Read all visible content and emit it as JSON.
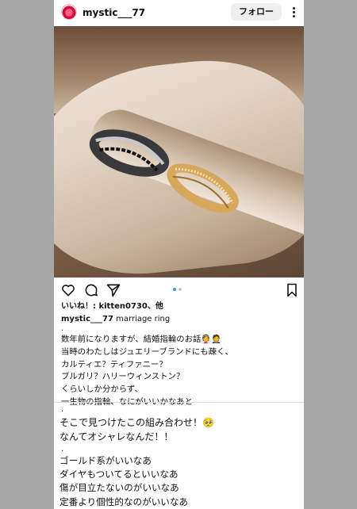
{
  "post": {
    "username": "mystic___77",
    "follow_label": "フォロー",
    "likes_text": "いいね！: kitten0730、他",
    "caption_user": "mystic___77",
    "caption_text": "marriage ring",
    "caption_dot": ".",
    "body_part1": "数年前になりますが、結婚指輪のお話👰🤵\n当時のわたしはジュエリーブランドにも疎く、\nカルティエ？ティファニー？\nブルガリ？ハリーウィンストン？\nくらいしか分からず、\n一生物の指輪、なにがいいかなあと",
    "body_dot": ".",
    "body_part2": "そこで見つけたこの組み合わせ！🥺\nなんてオシャレなんだ！！",
    "body_dot2": ".",
    "body_part3": "ゴールド系がいいなあ\nダイヤもついてるといいなあ\n傷が目立たないのがいいなあ\n定番より個性的なのがいいなあ"
  },
  "carousel": {
    "count": 2,
    "active": 0
  },
  "icons": {
    "like": "heart-icon",
    "comment": "comment-icon",
    "share": "send-icon",
    "save": "bookmark-icon",
    "more": "more-vertical-icon"
  },
  "colors": {
    "accent": "#3797f0",
    "follow_bg": "#efefef",
    "page_bg": "#a7a7a7"
  }
}
